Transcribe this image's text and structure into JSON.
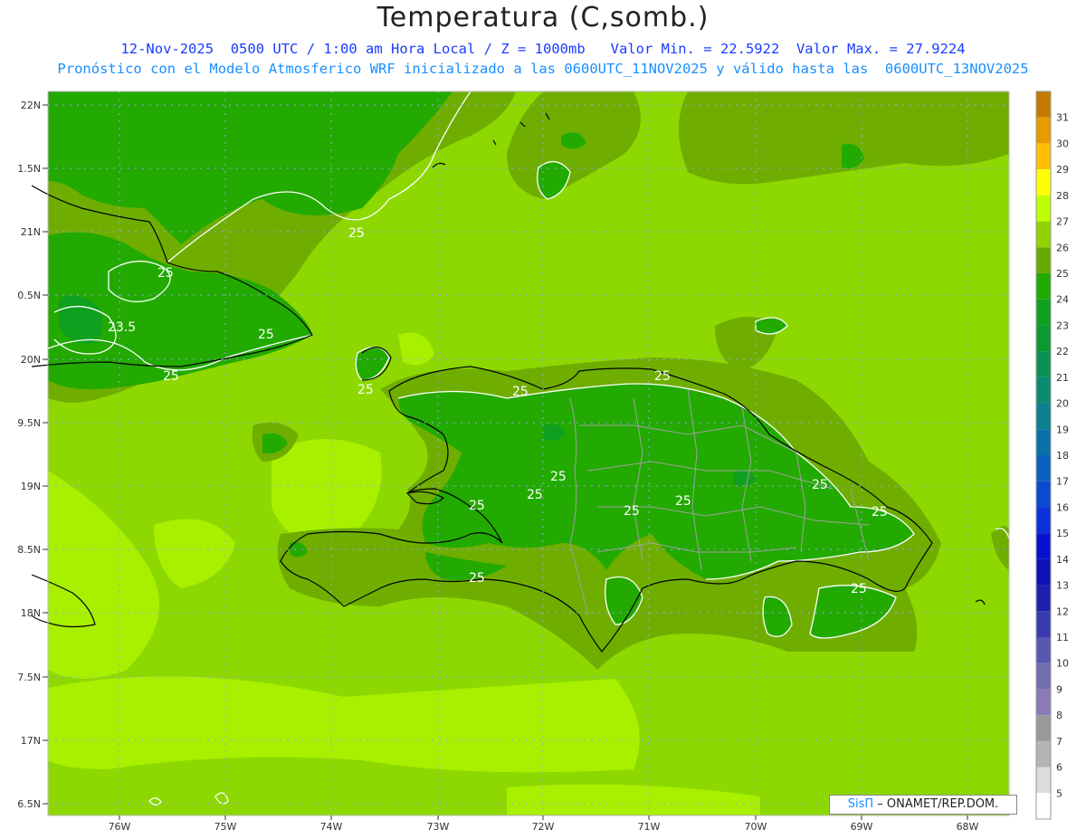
{
  "header": {
    "title": "Temperatura (C,somb.)",
    "line1": "12-Nov-2025  0500 UTC / 1:00 am Hora Local / Z = 1000mb   Valor Min. = 22.5922  Valor Max. = 27.9224",
    "line2": "Pronóstico con el Modelo Atmosferico WRF inicializado a las 0600UTC_11NOV2025 y válido hasta las  0600UTC_13NOV2025"
  },
  "axes": {
    "lat_labels": [
      "22N",
      "1.5N",
      "21N",
      "0.5N",
      "20N",
      "9.5N",
      "19N",
      "8.5N",
      "18N",
      "7.5N",
      "17N",
      "6.5N"
    ],
    "lon_labels": [
      "76W",
      "75W",
      "74W",
      "73W",
      "72W",
      "71W",
      "70W",
      "69W",
      "68W"
    ]
  },
  "colorbar": {
    "labels": [
      "31",
      "30",
      "29",
      "28",
      "27",
      "26",
      "25",
      "24",
      "23",
      "22",
      "21",
      "20",
      "19",
      "18",
      "17",
      "16",
      "15",
      "14",
      "13",
      "12",
      "11",
      "10",
      "9",
      "8",
      "7",
      "6",
      "5"
    ],
    "colors": [
      "#c47a00",
      "#e89a00",
      "#ffbf00",
      "#ffff00",
      "#bfff00",
      "#8fd400",
      "#6aaa00",
      "#22aa00",
      "#10a020",
      "#0a9a30",
      "#0a9050",
      "#0a8a70",
      "#0a8090",
      "#0a70a8",
      "#0a60c0",
      "#0a4ad0",
      "#0a30d8",
      "#0a10d0",
      "#1010b8",
      "#2020b0",
      "#3a3ab0",
      "#5858b0",
      "#7070b0",
      "#8c7ab8",
      "#999999",
      "#b4b4b4",
      "#dcdcdc",
      "#ffffff"
    ]
  },
  "contour_labels": [
    "25",
    "25",
    "23.5",
    "25",
    "25",
    "25",
    "25",
    "25",
    "25",
    "25",
    "25",
    "25",
    "25",
    "25",
    "25",
    "25"
  ],
  "credit": {
    "sis": "SisΠ",
    "rest": "– ONAMET/REP.DOM."
  },
  "colors": {
    "warm_26": "#8cd800",
    "band_25_26": "#6fae00",
    "band_24_25": "#22aa00",
    "warm_27": "#a8f000"
  }
}
